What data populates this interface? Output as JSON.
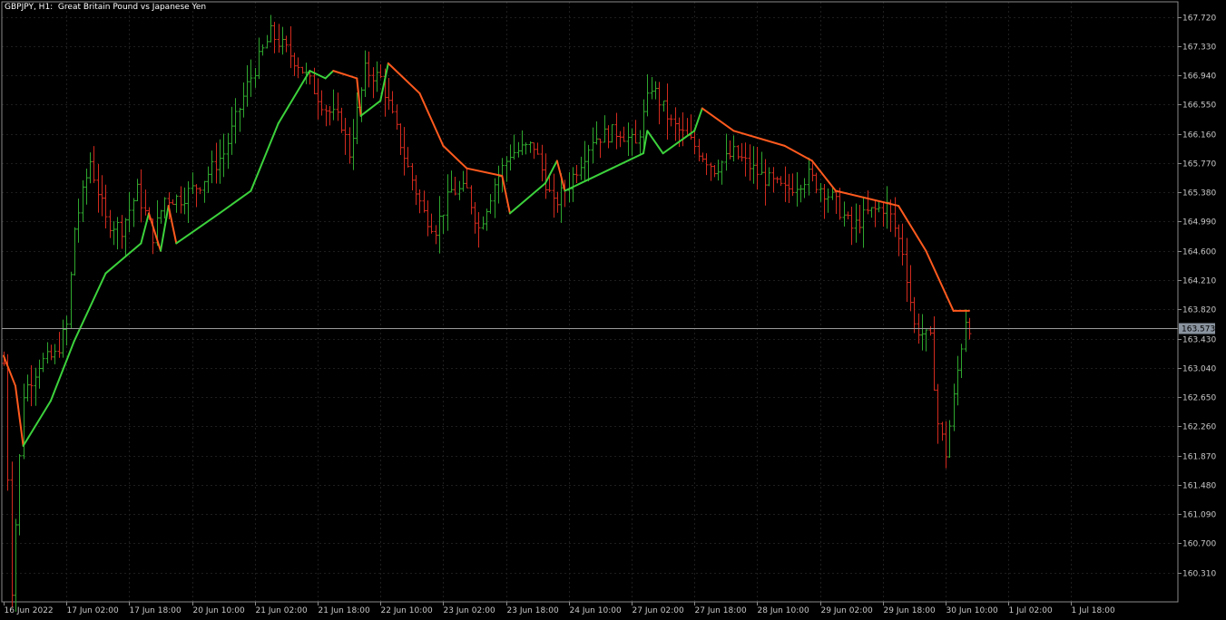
{
  "chart_title": "GBPJPY, H1:  Great Britain Pound vs Japanese Yen",
  "colors": {
    "background": "#000000",
    "grid": "#1e1e1e",
    "axis": "#8a8a8a",
    "bull": "#2ea62e",
    "bear": "#d22a1e",
    "trend_up": "#3cd23c",
    "trend_down": "#ff5a1e",
    "current_line": "#9a9a9a",
    "current_box": "#8a94a0"
  },
  "chart_data": {
    "type": "candlestick-bars",
    "symbol": "GBPJPY",
    "timeframe": "H1",
    "ylim": [
      159.92,
      167.92
    ],
    "y_ticks": [
      "167.720",
      "167.330",
      "166.940",
      "166.550",
      "166.160",
      "165.770",
      "165.380",
      "164.990",
      "164.600",
      "164.210",
      "163.820",
      "163.430",
      "163.040",
      "162.650",
      "162.260",
      "161.870",
      "161.480",
      "161.090",
      "160.700",
      "160.310"
    ],
    "x_ticks": [
      "16 Jun 2022",
      "17 Jun 02:00",
      "17 Jun 18:00",
      "20 Jun 10:00",
      "21 Jun 02:00",
      "21 Jun 18:00",
      "22 Jun 10:00",
      "23 Jun 02:00",
      "23 Jun 18:00",
      "24 Jun 10:00",
      "27 Jun 02:00",
      "27 Jun 18:00",
      "28 Jun 10:00",
      "29 Jun 02:00",
      "29 Jun 18:00",
      "30 Jun 10:00",
      "1 Jul 02:00",
      "1 Jul 18:00"
    ],
    "current_price": "163.573",
    "grid": true,
    "bars_per_tick": 16,
    "price_path": [
      [
        0,
        163.1
      ],
      [
        2,
        160.1
      ],
      [
        5,
        162.7
      ],
      [
        9,
        163.1
      ],
      [
        13,
        163.2
      ],
      [
        16,
        163.6
      ],
      [
        18,
        164.9
      ],
      [
        22,
        165.8
      ],
      [
        26,
        165.0
      ],
      [
        30,
        164.9
      ],
      [
        34,
        165.4
      ],
      [
        38,
        164.8
      ],
      [
        41,
        165.3
      ],
      [
        45,
        165.3
      ],
      [
        50,
        165.5
      ],
      [
        56,
        165.9
      ],
      [
        62,
        166.8
      ],
      [
        68,
        167.5
      ],
      [
        75,
        167.1
      ],
      [
        82,
        166.5
      ],
      [
        86,
        166.3
      ],
      [
        88,
        165.9
      ],
      [
        92,
        167.0
      ],
      [
        96,
        166.9
      ],
      [
        100,
        166.2
      ],
      [
        103,
        165.7
      ],
      [
        107,
        165.1
      ],
      [
        110,
        164.9
      ],
      [
        114,
        165.4
      ],
      [
        118,
        165.4
      ],
      [
        121,
        164.9
      ],
      [
        125,
        165.5
      ],
      [
        129,
        165.9
      ],
      [
        135,
        166.0
      ],
      [
        140,
        165.2
      ],
      [
        144,
        165.5
      ],
      [
        150,
        166.1
      ],
      [
        157,
        166.2
      ],
      [
        161,
        166.0
      ],
      [
        165,
        166.8
      ],
      [
        170,
        166.3
      ],
      [
        176,
        166.0
      ],
      [
        181,
        165.7
      ],
      [
        186,
        165.9
      ],
      [
        193,
        165.6
      ],
      [
        199,
        165.4
      ],
      [
        205,
        165.6
      ],
      [
        211,
        165.3
      ],
      [
        216,
        164.9
      ],
      [
        220,
        165.1
      ],
      [
        225,
        165.2
      ],
      [
        229,
        164.6
      ],
      [
        232,
        163.6
      ],
      [
        236,
        163.4
      ],
      [
        238,
        162.3
      ],
      [
        240,
        161.9
      ],
      [
        243,
        163.0
      ],
      [
        245,
        163.7
      ],
      [
        246,
        163.6
      ]
    ],
    "trend_line": [
      [
        0,
        163.2,
        "down"
      ],
      [
        3,
        162.8,
        "down"
      ],
      [
        5,
        162.0,
        "up"
      ],
      [
        12,
        162.6,
        "up"
      ],
      [
        18,
        163.4,
        "up"
      ],
      [
        26,
        164.3,
        "up"
      ],
      [
        35,
        164.7,
        "up"
      ],
      [
        37,
        165.1,
        "down"
      ],
      [
        40,
        164.6,
        "up"
      ],
      [
        42,
        165.2,
        "down"
      ],
      [
        44,
        164.7,
        "up"
      ],
      [
        55,
        165.1,
        "up"
      ],
      [
        63,
        165.4,
        "up"
      ],
      [
        70,
        166.3,
        "up"
      ],
      [
        78,
        167.0,
        "up"
      ],
      [
        82,
        166.9,
        "up"
      ],
      [
        84,
        167.0,
        "down"
      ],
      [
        90,
        166.9,
        "down"
      ],
      [
        91,
        166.4,
        "up"
      ],
      [
        96,
        166.6,
        "up"
      ],
      [
        98,
        167.1,
        "down"
      ],
      [
        106,
        166.7,
        "down"
      ],
      [
        112,
        166.0,
        "down"
      ],
      [
        118,
        165.7,
        "down"
      ],
      [
        127,
        165.6,
        "down"
      ],
      [
        129,
        165.1,
        "up"
      ],
      [
        138,
        165.5,
        "up"
      ],
      [
        141,
        165.8,
        "down"
      ],
      [
        143,
        165.4,
        "up"
      ],
      [
        155,
        165.7,
        "up"
      ],
      [
        163,
        165.9,
        "up"
      ],
      [
        164,
        166.2,
        "up"
      ],
      [
        168,
        165.9,
        "up"
      ],
      [
        176,
        166.2,
        "up"
      ],
      [
        178,
        166.5,
        "down"
      ],
      [
        186,
        166.2,
        "down"
      ],
      [
        199,
        166.0,
        "down"
      ],
      [
        206,
        165.8,
        "down"
      ],
      [
        212,
        165.4,
        "down"
      ],
      [
        228,
        165.2,
        "down"
      ],
      [
        235,
        164.6,
        "down"
      ],
      [
        242,
        163.8,
        "down"
      ],
      [
        246,
        163.8,
        "down"
      ]
    ]
  }
}
